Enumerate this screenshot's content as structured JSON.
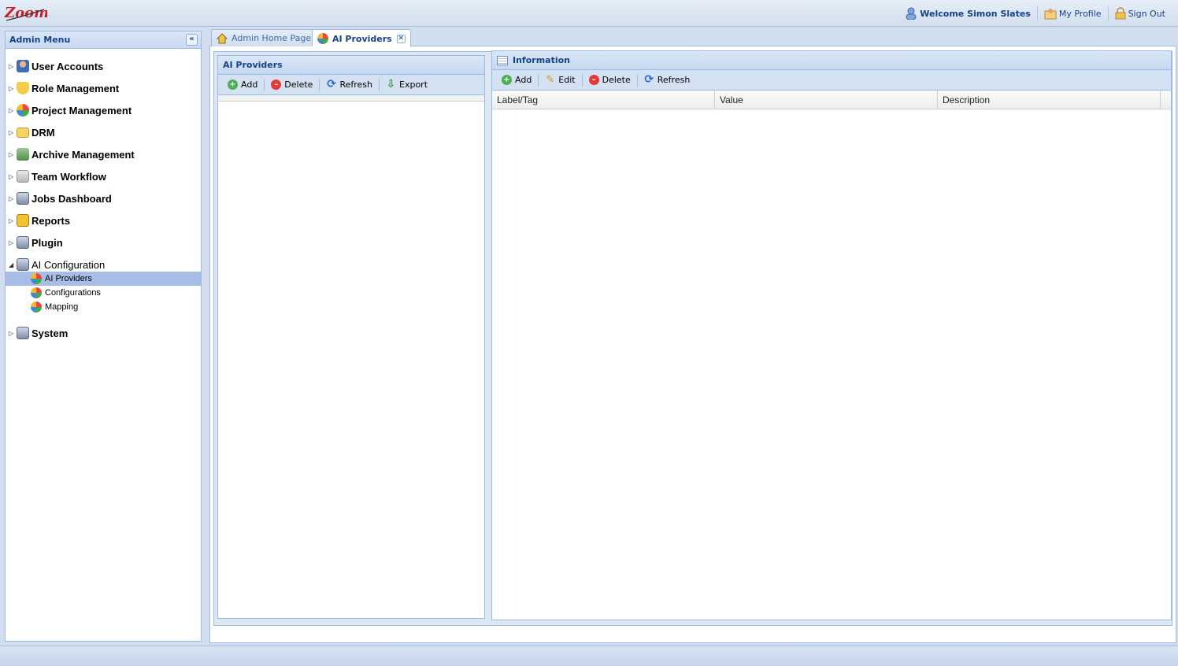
{
  "header": {
    "logo_text": "Zoom",
    "welcome": "Welcome Simon Slates",
    "my_profile": "My Profile",
    "sign_out": "Sign Out"
  },
  "sidebar": {
    "title": "Admin Menu",
    "items": [
      {
        "label": "User Accounts",
        "icon": "user-icon"
      },
      {
        "label": "Role Management",
        "icon": "shield-icon"
      },
      {
        "label": "Project Management",
        "icon": "globe-icon"
      },
      {
        "label": "DRM",
        "icon": "folder-icon"
      },
      {
        "label": "Archive Management",
        "icon": "archive-icon"
      },
      {
        "label": "Team Workflow",
        "icon": "workflow-icon"
      },
      {
        "label": "Jobs Dashboard",
        "icon": "monitor-icon"
      },
      {
        "label": "Reports",
        "icon": "reports-icon"
      },
      {
        "label": "Plugin",
        "icon": "monitor-icon"
      }
    ],
    "ai_config": {
      "label": "AI Configuration",
      "children": [
        "AI Providers",
        "Configurations",
        "Mapping"
      ],
      "selected": "AI Providers"
    },
    "system": {
      "label": "System"
    }
  },
  "tabs": [
    {
      "label": "Admin Home Page",
      "active": false
    },
    {
      "label": "AI Providers",
      "active": true
    }
  ],
  "left_panel": {
    "title": "AI Providers",
    "toolbar": {
      "add": "Add",
      "delete": "Delete",
      "refresh": "Refresh",
      "export": "Export"
    }
  },
  "right_panel": {
    "title": "Information",
    "toolbar": {
      "add": "Add",
      "edit": "Edit",
      "delete": "Delete",
      "refresh": "Refresh"
    },
    "columns": [
      "Label/Tag",
      "Value",
      "Description"
    ]
  },
  "colors": {
    "accent": "#15428b",
    "selection": "#a7bde6",
    "border": "#99bbe8"
  }
}
